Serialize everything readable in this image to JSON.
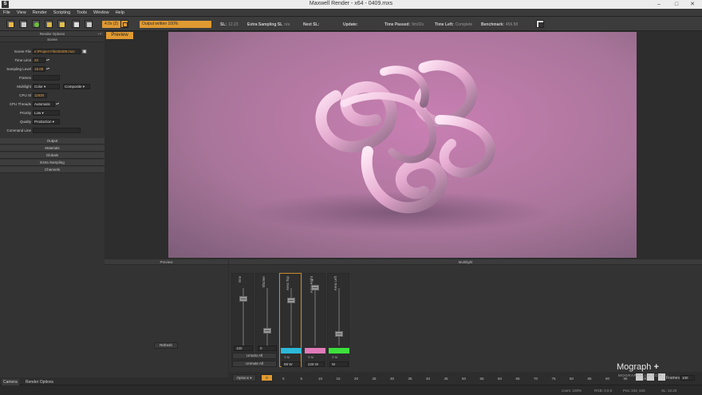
{
  "window": {
    "title": "Maxwell Render  -  x64 - 0409.mxs"
  },
  "menu": [
    "File",
    "View",
    "Render",
    "Scripting",
    "Tools",
    "Window",
    "Help"
  ],
  "toolbar": {
    "engine_label": "4.0x (2)",
    "output_label": "Output written 100%",
    "stats": {
      "sl_label": "SL:",
      "sl_value": "12.23",
      "es_label": "Extra Sampling SL",
      "es_value": "n/a",
      "next_label": "Next SL:",
      "next_value": "",
      "update_label": "Update:",
      "update_value": "",
      "passed_label": "Time Passed:",
      "passed_value": "9m32s",
      "left_label": "Time Left:",
      "left_value": "Complete",
      "bench_label": "Benchmark:",
      "bench_value": "456.58"
    }
  },
  "left_panel": {
    "header": "Render Options",
    "scene_header": "Scene",
    "scene_file_label": "Scene File",
    "scene_file_value": "e:\\Project Files\\0409.mxs",
    "time_limit_label": "Time Limit",
    "time_limit_value": "20",
    "sampling_label": "Sampling Level",
    "sampling_value": "18.00",
    "frames_label": "Frames",
    "multilight_label": "Multilight",
    "multilight_value": "Color",
    "multilight_mode": "Composite",
    "cpu_sl_label": "CPU Sl",
    "cpu_sl_value": "11930",
    "cpu_threads_label": "CPU Threads",
    "cpu_threads_value": "Automatic",
    "priority_label": "Priority",
    "priority_value": "Low",
    "quality_label": "Quality",
    "quality_value": "Production",
    "command_label": "Command Line",
    "sections": [
      "Output",
      "Materials",
      "Globals",
      "Extra Sampling",
      "Channels"
    ]
  },
  "preview_tab": "Preview",
  "bottom_left": {
    "header": "Preview",
    "refresh": "Refresh"
  },
  "multilight": {
    "header": "Multilight",
    "channels": [
      {
        "name": "Env",
        "value": "100",
        "color": ""
      },
      {
        "name": "Shutter",
        "value": "0",
        "color": ""
      },
      {
        "name": "Area Top",
        "value": "98",
        "color": "#2cb8d8"
      },
      {
        "name": "Area Right",
        "value": "228",
        "color": "#e07ab8"
      },
      {
        "name": "Area Left",
        "value": "",
        "color": "#3ce03c"
      }
    ],
    "sm_label": "S   M",
    "unit_w": "W",
    "unmute_all": "Unsolo All",
    "unmute_all2": "Unmute All",
    "options_label": "Options",
    "frame_field": "0",
    "frames_label": "Frames",
    "frames_value": "100"
  },
  "timeline_ticks": [
    "0",
    "5",
    "10",
    "15",
    "20",
    "25",
    "30",
    "35",
    "40",
    "45",
    "50",
    "55",
    "60",
    "65",
    "70",
    "75",
    "80",
    "85",
    "90",
    "95",
    "100"
  ],
  "bottom_tabs": [
    "Camera",
    "Render Options"
  ],
  "status": {
    "zoom": "zoom: 100%",
    "rgb": "RGB: 0,0,0",
    "pos": "Pos: 242, 615",
    "sl": "SL: 12.23"
  },
  "watermark": {
    "line1": "Mograph",
    "line2": "MOGRAPHPLUS.COM"
  }
}
